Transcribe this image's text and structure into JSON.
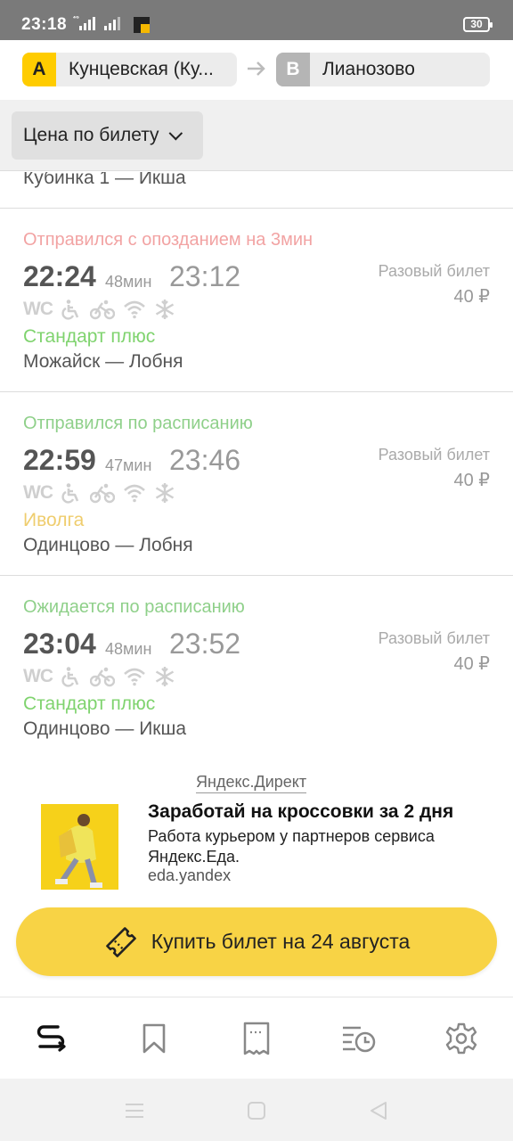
{
  "status_bar": {
    "time": "23:18",
    "network": "4G",
    "battery": "30"
  },
  "route": {
    "from_letter": "A",
    "from_name": "Кунцевская (Ку...",
    "to_letter": "B",
    "to_name": "Лианозово"
  },
  "filter": {
    "label": "Цена по билету"
  },
  "partial_row": {
    "direction": "Кубинка 1 — Икша"
  },
  "trains": [
    {
      "status": "Отправился с опозданием на 3мин",
      "status_color": "#f2a3a3",
      "departure": "22:24",
      "duration": "48мин",
      "arrival": "23:12",
      "ticket": "Разовый билет",
      "price": "40 ₽",
      "category": "Стандарт плюс",
      "category_color": "#7fd36e",
      "direction": "Можайск — Лобня"
    },
    {
      "status": "Отправился по расписанию",
      "status_color": "#8fd08a",
      "departure": "22:59",
      "duration": "47мин",
      "arrival": "23:46",
      "ticket": "Разовый билет",
      "price": "40 ₽",
      "category": "Иволга",
      "category_color": "#efcd6e",
      "direction": "Одинцово — Лобня"
    },
    {
      "status": "Ожидается по расписанию",
      "status_color": "#8fd08a",
      "departure": "23:04",
      "duration": "48мин",
      "arrival": "23:52",
      "ticket": "Разовый билет",
      "price": "40 ₽",
      "category": "Стандарт плюс",
      "category_color": "#7fd36e",
      "direction": "Одинцово — Икша"
    }
  ],
  "amenities": {
    "wc": "WC",
    "icons": [
      "wheelchair-icon",
      "bicycle-icon",
      "wifi-icon",
      "snowflake-icon"
    ]
  },
  "ad": {
    "label": "Яндекс.Директ",
    "title": "Заработай на кроссовки за 2 дня",
    "text": "Работа курьером у партнеров сервиса Яндекс.Еда.",
    "domain": "eda.yandex"
  },
  "buy_button": {
    "label": "Купить билет на 24 августа",
    "color": "#f8d345"
  },
  "tabs": [
    "route-icon",
    "bookmark-icon",
    "ticket-icon",
    "history-icon",
    "settings-icon"
  ],
  "nav_buttons": [
    "menu-icon",
    "home-icon",
    "back-icon"
  ]
}
